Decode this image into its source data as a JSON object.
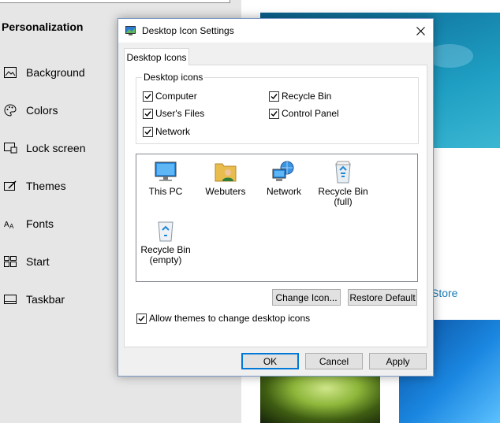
{
  "settings": {
    "heading": "Personalization",
    "nav": [
      {
        "label": "Background",
        "icon": "picture-icon"
      },
      {
        "label": "Colors",
        "icon": "palette-icon"
      },
      {
        "label": "Lock screen",
        "icon": "lock-screen-icon"
      },
      {
        "label": "Themes",
        "icon": "themes-icon"
      },
      {
        "label": "Fonts",
        "icon": "fonts-icon"
      },
      {
        "label": "Start",
        "icon": "start-icon"
      },
      {
        "label": "Taskbar",
        "icon": "taskbar-icon"
      }
    ],
    "store_link": "Store"
  },
  "dialog": {
    "title": "Desktop Icon Settings",
    "tab": "Desktop Icons",
    "group_title": "Desktop icons",
    "checkboxes": [
      {
        "label": "Computer",
        "checked": true
      },
      {
        "label": "Recycle Bin",
        "checked": true
      },
      {
        "label": "User's Files",
        "checked": true
      },
      {
        "label": "Control Panel",
        "checked": true
      },
      {
        "label": "Network",
        "checked": true
      }
    ],
    "icons": [
      {
        "label": "This PC",
        "icon": "monitor-icon"
      },
      {
        "label": "Webuters",
        "icon": "user-folder-icon"
      },
      {
        "label": "Network",
        "icon": "network-icon"
      },
      {
        "label": "Recycle Bin\n(full)",
        "icon": "recycle-bin-full-icon"
      },
      {
        "label": "Recycle Bin\n(empty)",
        "icon": "recycle-bin-empty-icon"
      }
    ],
    "change_icon": "Change Icon...",
    "restore_default": "Restore Default",
    "allow_themes": {
      "label": "Allow themes to change desktop icons",
      "checked": true
    },
    "ok": "OK",
    "cancel": "Cancel",
    "apply": "Apply"
  },
  "colors": {
    "accent": "#0078d7",
    "link": "#1a7ab5"
  }
}
